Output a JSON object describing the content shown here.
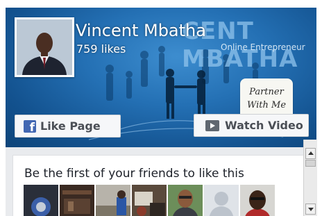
{
  "page": {
    "name": "Vincent Mbatha",
    "likes": "759 likes"
  },
  "cover": {
    "brand_word": "CENT MBATHA",
    "brand_subtitle": "Online Entrepreneur",
    "callout": [
      "Partner",
      "With Me"
    ]
  },
  "buttons": {
    "like_label": "Like Page",
    "watch_label": "Watch Video"
  },
  "friends": {
    "prompt": "Be the first of your friends to like this",
    "faces": [
      "friend-photo-1",
      "friend-photo-2",
      "friend-photo-3",
      "friend-photo-4",
      "friend-photo-5",
      "friend-photo-6",
      "friend-photo-7"
    ]
  },
  "icons": {
    "like": "facebook-f-icon",
    "watch": "play-video-icon"
  },
  "colors": {
    "cover_blue": "#2470b4",
    "facebook_blue": "#4267b2",
    "button_text": "#4b4f56"
  }
}
